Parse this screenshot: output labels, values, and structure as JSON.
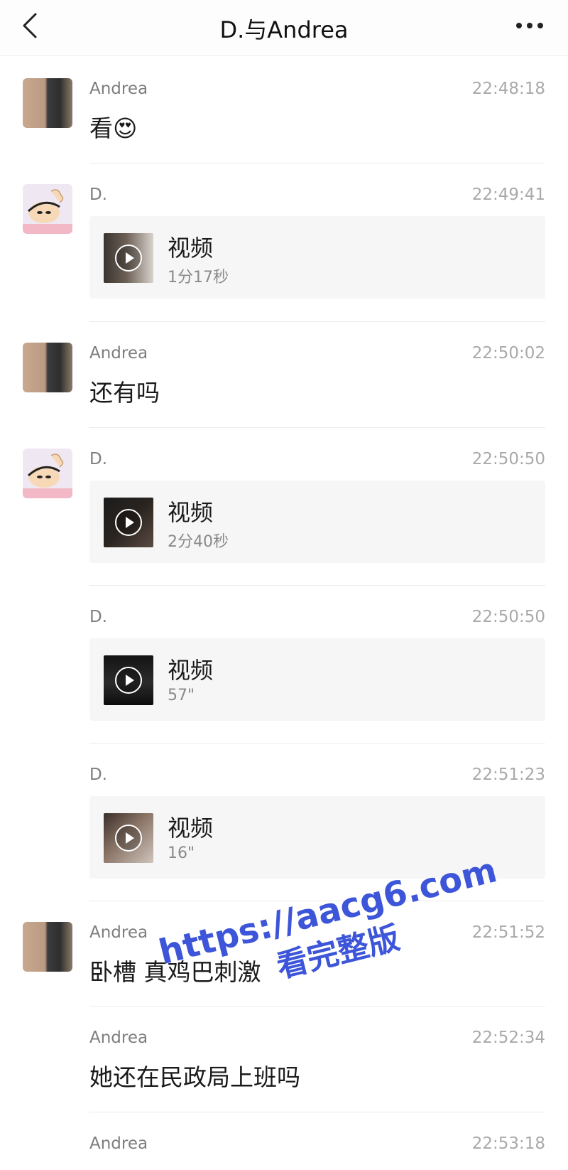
{
  "header": {
    "title": "D.与Andrea",
    "back_icon": "chevron-left-icon",
    "more_icon": "more-dots-icon"
  },
  "messages": [
    {
      "sender": "Andrea",
      "time": "22:48:18",
      "type": "text",
      "text": "看😍"
    },
    {
      "sender": "D.",
      "time": "22:49:41",
      "type": "video",
      "label": "视频",
      "duration": "1分17秒"
    },
    {
      "sender": "Andrea",
      "time": "22:50:02",
      "type": "text",
      "text": "还有吗"
    },
    {
      "sender": "D.",
      "time": "22:50:50",
      "type": "video",
      "label": "视频",
      "duration": "2分40秒"
    },
    {
      "sender": "D.",
      "time": "22:50:50",
      "type": "video",
      "label": "视频",
      "duration": "57\""
    },
    {
      "sender": "D.",
      "time": "22:51:23",
      "type": "video",
      "label": "视频",
      "duration": "16\""
    },
    {
      "sender": "Andrea",
      "time": "22:51:52",
      "type": "text",
      "text": "卧槽 真鸡巴刺激"
    },
    {
      "sender": "Andrea",
      "time": "22:52:34",
      "type": "text",
      "text": "她还在民政局上班吗"
    },
    {
      "sender": "Andrea",
      "time": "22:53:18",
      "type": "text",
      "text": ""
    }
  ],
  "watermark": {
    "url": "https://aacg6.com",
    "cta": "看完整版"
  },
  "colors": {
    "watermark": "#3d55d8",
    "card_bg": "#f6f6f6",
    "time_gray": "#a9a9a9",
    "sender_gray": "#7d7d7d"
  }
}
